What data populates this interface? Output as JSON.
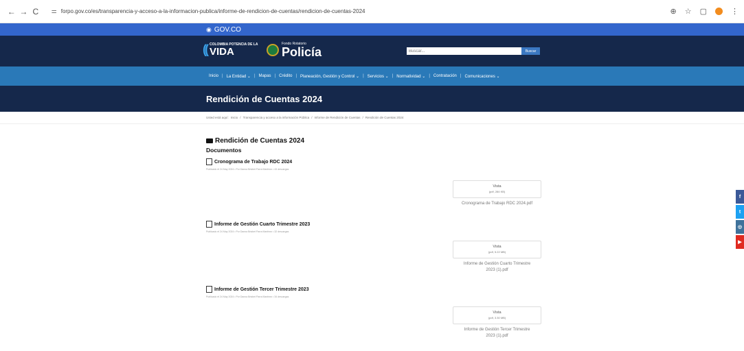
{
  "browser": {
    "back": "←",
    "forward": "→",
    "reload": "C",
    "url": "forpo.gov.co/es/transparencia-y-acceso-a-la-informacion-publica/informe-de-rendicion-de-cuentas/rendicion-de-cuentas-2024"
  },
  "gov": {
    "label": "GOV.CO"
  },
  "header": {
    "vida_small": "COLOMBIA POTENCIA DE LA",
    "vida_big": "VIDA",
    "policia_small": "Fondo Rotatorio",
    "policia_big": "Policía",
    "search_placeholder": "Buscar...",
    "search_button": "Buscar"
  },
  "menu": [
    "Inicio",
    "La Entidad ⌄",
    "Mapas",
    "Crédito",
    "Planeación, Gestión y Control ⌄",
    "Servicios ⌄",
    "Normatividad ⌄",
    "Contratación",
    "Comunicaciones ⌄"
  ],
  "page": {
    "title": "Rendición de Cuentas 2024",
    "breadcrumb": [
      "Usted está aquí:",
      "Inicio",
      "Transparencia y acceso a la información Pública",
      "Informe de Rendición de Cuentas",
      "Rendición de Cuentas 2024"
    ],
    "section_title": "Rendición de Cuentas 2024",
    "section_sub": "Documentos"
  },
  "documents": [
    {
      "title": "Cronograma de Trabajo RDC 2024",
      "meta": "Publicado el 24 May 2024 • Por Danna Brisbet Parra Martínez • 43 descargas",
      "view": "Vista",
      "size": "(pdf, 284 KB)",
      "file_line1": "Cronograma de Trabajo RDC 2024.pdf",
      "file_line2": ""
    },
    {
      "title": "Informe de Gestión Cuarto Trimestre 2023",
      "meta": "Publicado el 24 May 2024 • Por Danna Brisbet Parra Martínez • 32 descargas",
      "view": "Vista",
      "size": "(pdf, 5.22 MB)",
      "file_line1": "Informe de Gestión Cuarto Trimestre",
      "file_line2": "2023 (1).pdf"
    },
    {
      "title": "Informe de Gestión Tercer Trimestre 2023",
      "meta": "Publicado el 24 May 2024 • Por Danna Brisbet Parra Martínez • 34 descargas",
      "view": "Vista",
      "size": "(pdf, 3.30 MB)",
      "file_line1": "Informe de Gestión Tercer Trimestre",
      "file_line2": "2023 (1).pdf"
    }
  ],
  "social": [
    {
      "glyph": "f",
      "color": "#3b5998"
    },
    {
      "glyph": "t",
      "color": "#1da1f2"
    },
    {
      "glyph": "◎",
      "color": "#3f729b"
    },
    {
      "glyph": "▶",
      "color": "#e02a20"
    }
  ]
}
